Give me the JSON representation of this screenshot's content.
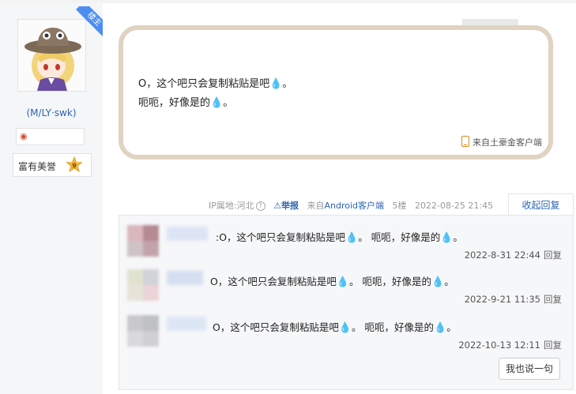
{
  "user": {
    "role_badge": "楼主",
    "username": "(M/LY·swk)",
    "honor_label": "富有美誉",
    "level": "9"
  },
  "post": {
    "line1": "O，这个吧只会复制粘贴是吧",
    "line2": "呃呃，好像是的",
    "punct": "。",
    "drop": "💧",
    "source": "来自土豪金客户端"
  },
  "meta": {
    "ip_location": "IP属地:河北",
    "report": "举报",
    "from_prefix": "来自",
    "client": "Android客户端",
    "floor": "5楼",
    "time": "2022-08-25 21:45",
    "collapse": "收起回复"
  },
  "replies": [
    {
      "text_a": ":O，这个吧只会复制粘贴是吧",
      "text_b": "。 呃呃，好像是的",
      "time": "2022-8-31 22:44",
      "reply": "回复"
    },
    {
      "text_a": "O，这个吧只会复制粘贴是吧",
      "text_b": "。 呃呃，好像是的",
      "time": "2022-9-21 11:35",
      "reply": "回复"
    },
    {
      "text_a": "O，这个吧只会复制粘贴是吧",
      "text_b": "。 呃呃，好像是的",
      "time": "2022-10-13 12:11",
      "reply": "回复"
    }
  ],
  "say_button": "我也说一句",
  "colors": {
    "accent": "#2d64b3",
    "bubble_border": "#e0d3c2",
    "drop": "#3a8fdc"
  }
}
